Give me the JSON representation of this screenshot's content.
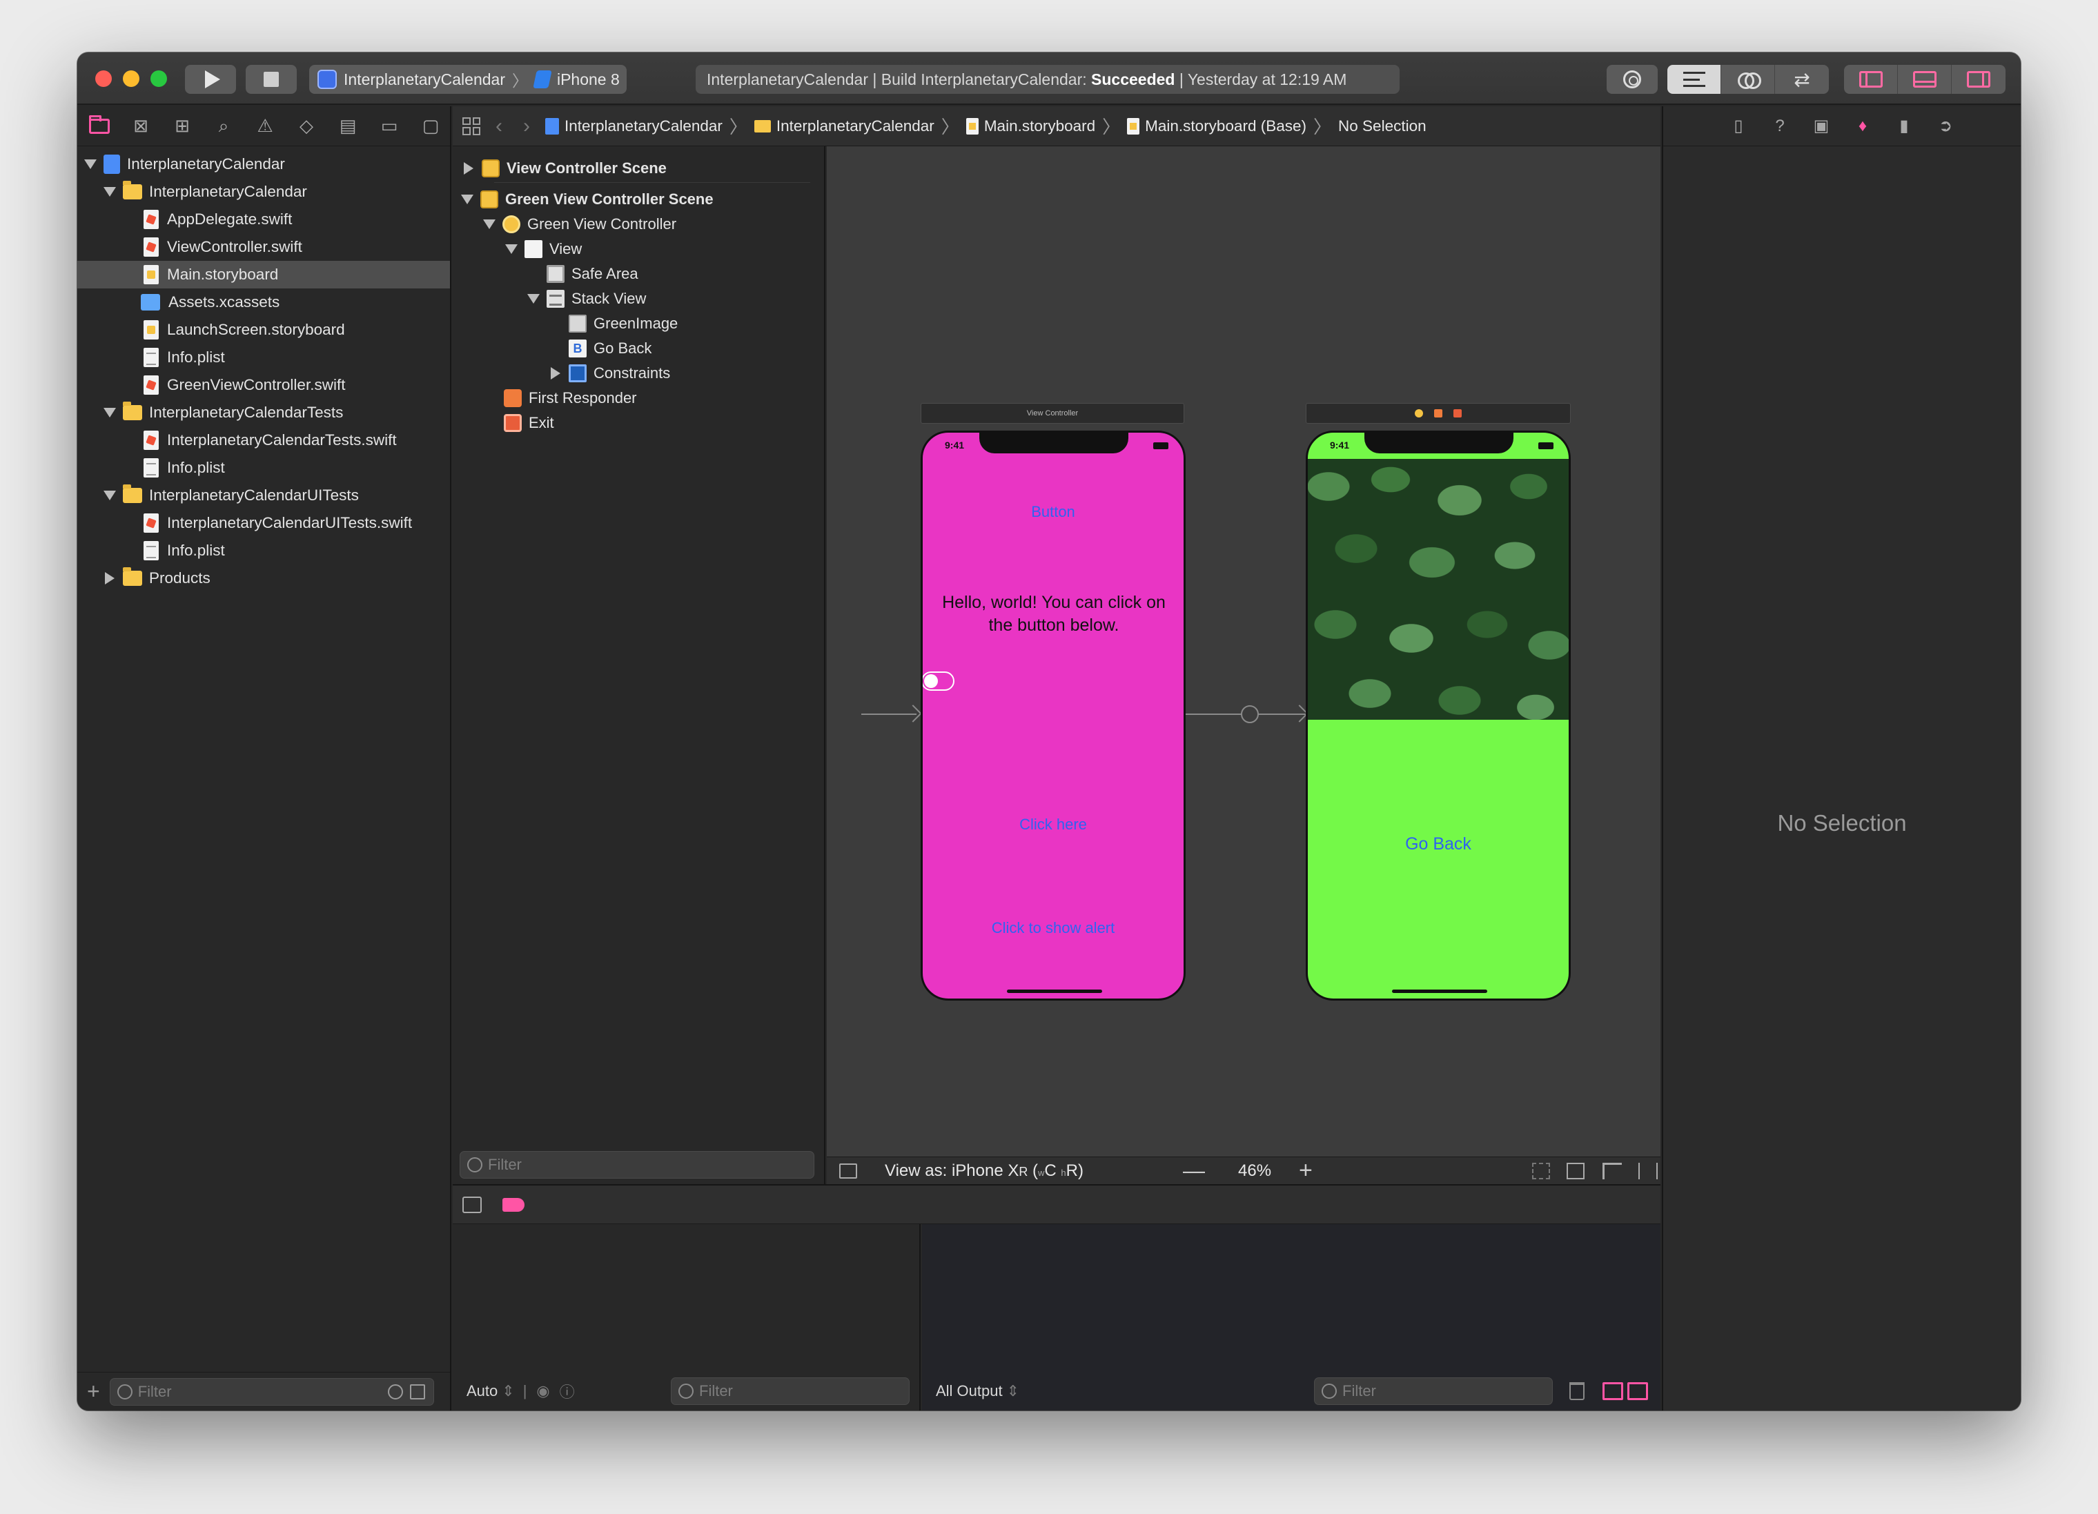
{
  "toolbar": {
    "scheme": "InterplanetaryCalendar",
    "device": "iPhone 8",
    "activity_prefix": "InterplanetaryCalendar | Build InterplanetaryCalendar: ",
    "activity_status": "Succeeded",
    "activity_suffix": " | Yesterday at 12:19 AM"
  },
  "navigator": {
    "items": [
      {
        "label": "InterplanetaryCalendar"
      },
      {
        "label": "InterplanetaryCalendar"
      },
      {
        "label": "AppDelegate.swift"
      },
      {
        "label": "ViewController.swift"
      },
      {
        "label": "Main.storyboard"
      },
      {
        "label": "Assets.xcassets"
      },
      {
        "label": "LaunchScreen.storyboard"
      },
      {
        "label": "Info.plist"
      },
      {
        "label": "GreenViewController.swift"
      },
      {
        "label": "InterplanetaryCalendarTests"
      },
      {
        "label": "InterplanetaryCalendarTests.swift"
      },
      {
        "label": "Info.plist"
      },
      {
        "label": "InterplanetaryCalendarUITests"
      },
      {
        "label": "InterplanetaryCalendarUITests.swift"
      },
      {
        "label": "Info.plist"
      },
      {
        "label": "Products"
      }
    ],
    "filter_placeholder": "Filter"
  },
  "jumpbar": {
    "crumbs": [
      "InterplanetaryCalendar",
      "InterplanetaryCalendar",
      "Main.storyboard",
      "Main.storyboard (Base)",
      "No Selection"
    ]
  },
  "outline": {
    "items": [
      {
        "label": "View Controller Scene"
      },
      {
        "label": "Green View Controller Scene"
      },
      {
        "label": "Green View Controller"
      },
      {
        "label": "View"
      },
      {
        "label": "Safe Area"
      },
      {
        "label": "Stack View"
      },
      {
        "label": "GreenImage"
      },
      {
        "label": "Go Back"
      },
      {
        "label": "Constraints"
      },
      {
        "label": "First Responder"
      },
      {
        "label": "Exit"
      }
    ],
    "filter_placeholder": "Filter"
  },
  "canvas": {
    "scene1_title": "View Controller",
    "status_time": "9:41",
    "pink": {
      "button": "Button",
      "hello": "Hello, world! You can click on the button below.",
      "click_here": "Click here",
      "alert": "Click to show alert"
    },
    "green": {
      "go_back": "Go Back"
    },
    "view_as_prefix": "View as: iPhone X",
    "view_as_model": "R",
    "view_as_traits": "(",
    "trait_w": "w",
    "trait_c": "C",
    "trait_h": "h",
    "trait_r": "R)",
    "zoom": "46%"
  },
  "inspector": {
    "no_selection": "No Selection"
  },
  "debug": {
    "auto": "Auto",
    "filter_placeholder": "Filter",
    "output": "All Output",
    "filter2_placeholder": "Filter"
  },
  "colors": {
    "accent": "#ff55a5",
    "pink_view": "#e935c4",
    "green_view": "#74f948",
    "link_blue": "#2f63f0"
  }
}
